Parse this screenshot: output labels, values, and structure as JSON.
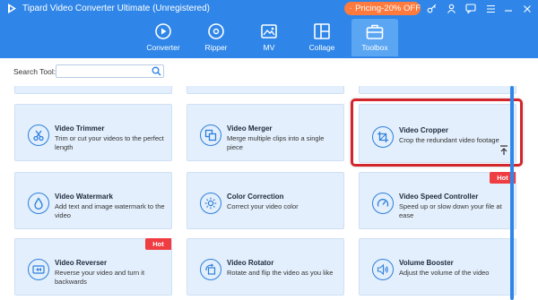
{
  "app": {
    "title": "Tipard Video Converter Ultimate (Unregistered)"
  },
  "promo": {
    "label": "Pricing-20% OFF"
  },
  "nav": [
    {
      "label": "Converter",
      "icon": "converter-icon"
    },
    {
      "label": "Ripper",
      "icon": "ripper-icon"
    },
    {
      "label": "MV",
      "icon": "mv-icon"
    },
    {
      "label": "Collage",
      "icon": "collage-icon"
    },
    {
      "label": "Toolbox",
      "icon": "toolbox-icon",
      "active": true
    }
  ],
  "search": {
    "label": "Search Tool:",
    "value": "",
    "placeholder": ""
  },
  "tools": [
    {
      "title": "Video Trimmer",
      "desc": "Trim or cut your videos to the perfect length",
      "icon": "scissors-icon",
      "hot": false
    },
    {
      "title": "Video Merger",
      "desc": "Merge multiple clips into a single piece",
      "icon": "merge-icon",
      "hot": false
    },
    {
      "title": "Video Cropper",
      "desc": "Crop the redundant video footage",
      "icon": "crop-icon",
      "hot": false,
      "highlighted": true
    },
    {
      "title": "Video Watermark",
      "desc": "Add text and image watermark to the video",
      "icon": "watermark-drop-icon",
      "hot": false
    },
    {
      "title": "Color Correction",
      "desc": "Correct your video color",
      "icon": "sun-icon",
      "hot": false
    },
    {
      "title": "Video Speed Controller",
      "desc": "Speed up or slow down your file at ease",
      "icon": "speedometer-icon",
      "hot": true
    },
    {
      "title": "Video Reverser",
      "desc": "Reverse your video and turn it backwards",
      "icon": "rewind-icon",
      "hot": true
    },
    {
      "title": "Video Rotator",
      "desc": "Rotate and flip the video as you like",
      "icon": "rotate-icon",
      "hot": false
    },
    {
      "title": "Volume Booster",
      "desc": "Adjust the volume of the video",
      "icon": "speaker-icon",
      "hot": false
    }
  ],
  "hot_label": "Hot",
  "colors": {
    "header": "#2f86e8",
    "card": "#e3effc",
    "accent": "#2d7fdc",
    "hot": "#ef3d42",
    "promo": "#ff7a3c",
    "highlight": "#d3252c"
  }
}
